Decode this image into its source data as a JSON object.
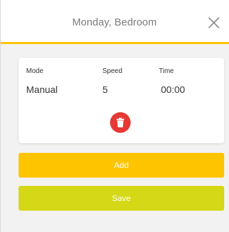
{
  "header": {
    "title": "Monday, Bedroom"
  },
  "schedule_card": {
    "mode_label": "Mode",
    "speed_label": "Speed",
    "time_label": "Time",
    "mode_value": "Manual",
    "speed_value": "5",
    "time_value": "00:00"
  },
  "actions": {
    "add_label": "Add",
    "save_label": "Save"
  },
  "colors": {
    "accent": "#ffc400",
    "save": "#d4d816",
    "delete": "#e53935"
  },
  "icons": {
    "close": "close-icon",
    "delete": "trash-icon"
  }
}
